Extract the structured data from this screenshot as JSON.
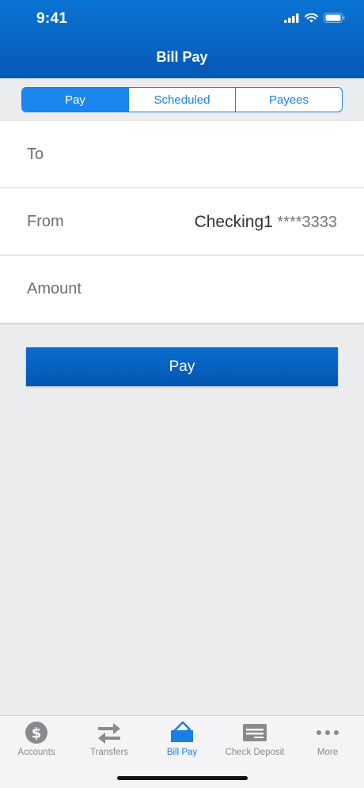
{
  "status_bar": {
    "time": "9:41"
  },
  "header": {
    "title": "Bill Pay"
  },
  "segments": [
    {
      "label": "Pay",
      "active": true
    },
    {
      "label": "Scheduled",
      "active": false
    },
    {
      "label": "Payees",
      "active": false
    }
  ],
  "form": {
    "to_label": "To",
    "from_label": "From",
    "from_account_name": "Checking1",
    "from_account_mask": "****3333",
    "amount_label": "Amount"
  },
  "pay_button_label": "Pay",
  "tabbar": {
    "items": [
      {
        "label": "Accounts",
        "icon": "dollar-coin-icon"
      },
      {
        "label": "Transfers",
        "icon": "transfer-arrows-icon"
      },
      {
        "label": "Bill Pay",
        "icon": "bill-pay-icon",
        "active": true
      },
      {
        "label": "Check Deposit",
        "icon": "check-icon"
      },
      {
        "label": "More",
        "icon": "ellipsis-icon"
      }
    ]
  },
  "colors": {
    "brand_blue": "#0558b5",
    "accent_blue": "#1a86ee",
    "tab_inactive": "#8a8a8e"
  }
}
